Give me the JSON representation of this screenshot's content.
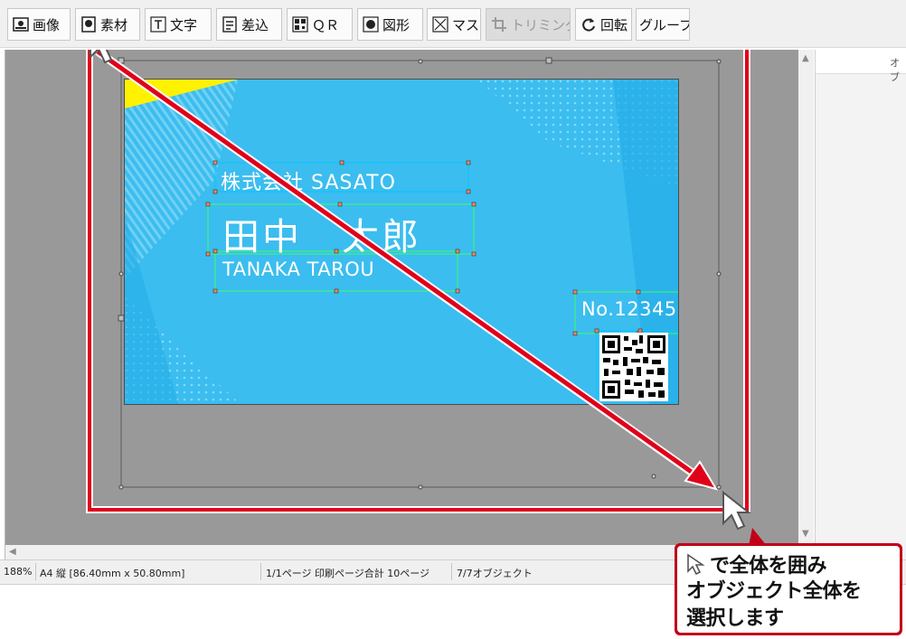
{
  "toolbar": {
    "buttons": [
      {
        "label": "画像",
        "icon": "image-icon"
      },
      {
        "label": "素材",
        "icon": "material-icon"
      },
      {
        "label": "文字",
        "icon": "text-icon"
      },
      {
        "label": "差込",
        "icon": "merge-icon"
      },
      {
        "label": "ＱＲ",
        "icon": "qr-icon"
      },
      {
        "label": "図形",
        "icon": "shape-icon"
      },
      {
        "label": "マスク",
        "icon": "mask-icon"
      },
      {
        "label": "トリミング",
        "icon": "trim-icon",
        "disabled": true
      },
      {
        "label": "回転",
        "icon": "rotate-icon"
      },
      {
        "label": "グループ",
        "icon": "group-icon"
      }
    ]
  },
  "card": {
    "company": "株式会社 SASATO",
    "name": "田中　太郎",
    "romaji": "TANAKA TAROU",
    "number": "No.12345",
    "bg_color": "#3bbdef",
    "accent_color": "#fff200"
  },
  "right_panel": {
    "header_fragment": "オブ"
  },
  "status": {
    "zoom": "188%",
    "paper": "A4 縦 [86.40mm x 50.80mm]",
    "pages": "1/1ページ 印刷ページ合計 10ページ",
    "objects": "7/7オブジェクト"
  },
  "callout": {
    "line1": "で全体を囲み",
    "line2": "オブジェクト全体を",
    "line3": "選択します",
    "border_color": "#c00018"
  },
  "overlay": {
    "selection_color": "#e0001a"
  }
}
